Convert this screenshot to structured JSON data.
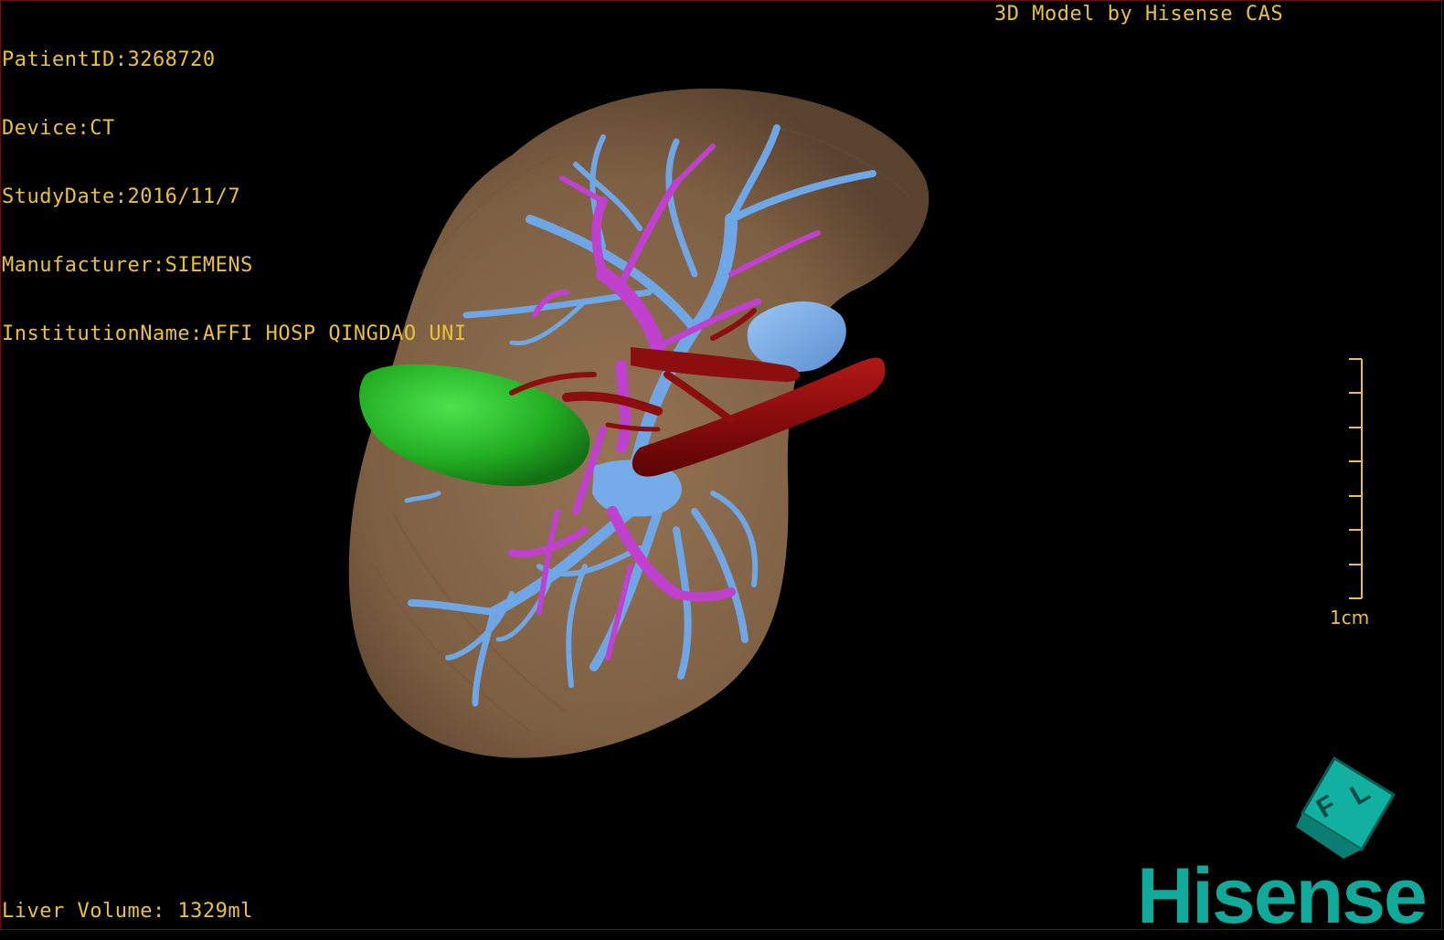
{
  "header": {
    "patient_id": "PatientID:3268720",
    "device": "Device:CT",
    "study_date": "StudyDate:2016/11/7",
    "manufacturer": "Manufacturer:SIEMENS",
    "institution": "InstitutionName:AFFI HOSP QINGDAO UNI"
  },
  "credit": "3D Model by Hisense CAS",
  "footer": {
    "liver_volume": "Liver Volume: 1329ml"
  },
  "scale_bar": {
    "label": "1cm",
    "ticks": 8
  },
  "orientation_cube": {
    "labels": [
      "F",
      "L"
    ]
  },
  "brand": {
    "name": "Hisense"
  },
  "colors": {
    "text": "#e8c23a",
    "liver": "#8a6a4a",
    "portal_vein": "#6fa6e6",
    "hepatic_vein": "#c040d0",
    "artery": "#8a0c0c",
    "gallbladder": "#27c027",
    "brand": "#11a99a"
  }
}
